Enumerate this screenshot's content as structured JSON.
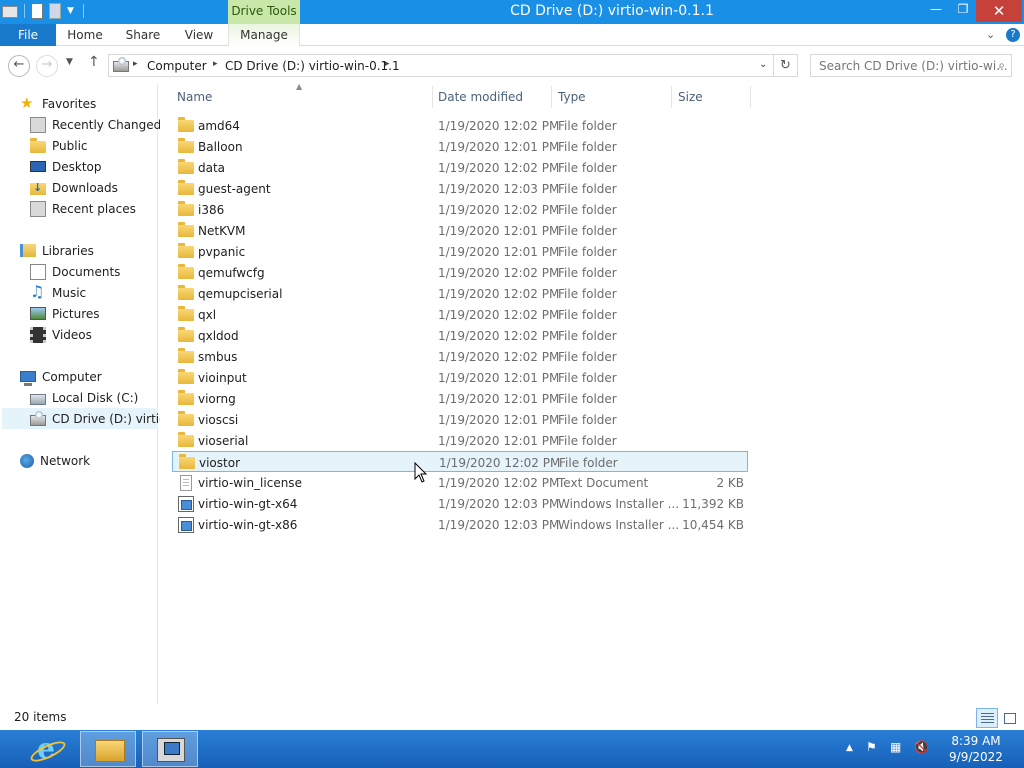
{
  "window": {
    "title": "CD Drive (D:) virtio-win-0.1.1",
    "context_tab": "Drive Tools"
  },
  "ribbon": {
    "tabs": [
      "File",
      "Home",
      "Share",
      "View",
      "Manage"
    ]
  },
  "address": {
    "crumbs": [
      "Computer",
      "CD Drive (D:) virtio-win-0.1.1"
    ],
    "search_placeholder": "Search CD Drive (D:) virtio-wi..."
  },
  "nav": {
    "favorites": "Favorites",
    "favorites_items": [
      "Recently Changed",
      "Public",
      "Desktop",
      "Downloads",
      "Recent places"
    ],
    "libraries": "Libraries",
    "libraries_items": [
      "Documents",
      "Music",
      "Pictures",
      "Videos"
    ],
    "computer": "Computer",
    "computer_items": [
      "Local Disk (C:)",
      "CD Drive (D:) virtio-w"
    ],
    "network": "Network"
  },
  "columns": {
    "name": "Name",
    "date": "Date modified",
    "type": "Type",
    "size": "Size"
  },
  "files": [
    {
      "name": "amd64",
      "date": "1/19/2020 12:02 PM",
      "type": "File folder",
      "size": "",
      "icon": "folder-icon"
    },
    {
      "name": "Balloon",
      "date": "1/19/2020 12:01 PM",
      "type": "File folder",
      "size": "",
      "icon": "folder-icon"
    },
    {
      "name": "data",
      "date": "1/19/2020 12:02 PM",
      "type": "File folder",
      "size": "",
      "icon": "folder-icon"
    },
    {
      "name": "guest-agent",
      "date": "1/19/2020 12:03 PM",
      "type": "File folder",
      "size": "",
      "icon": "folder-icon"
    },
    {
      "name": "i386",
      "date": "1/19/2020 12:02 PM",
      "type": "File folder",
      "size": "",
      "icon": "folder-icon"
    },
    {
      "name": "NetKVM",
      "date": "1/19/2020 12:01 PM",
      "type": "File folder",
      "size": "",
      "icon": "folder-icon"
    },
    {
      "name": "pvpanic",
      "date": "1/19/2020 12:01 PM",
      "type": "File folder",
      "size": "",
      "icon": "folder-icon"
    },
    {
      "name": "qemufwcfg",
      "date": "1/19/2020 12:02 PM",
      "type": "File folder",
      "size": "",
      "icon": "folder-icon"
    },
    {
      "name": "qemupciserial",
      "date": "1/19/2020 12:02 PM",
      "type": "File folder",
      "size": "",
      "icon": "folder-icon"
    },
    {
      "name": "qxl",
      "date": "1/19/2020 12:02 PM",
      "type": "File folder",
      "size": "",
      "icon": "folder-icon"
    },
    {
      "name": "qxldod",
      "date": "1/19/2020 12:02 PM",
      "type": "File folder",
      "size": "",
      "icon": "folder-icon"
    },
    {
      "name": "smbus",
      "date": "1/19/2020 12:02 PM",
      "type": "File folder",
      "size": "",
      "icon": "folder-icon"
    },
    {
      "name": "vioinput",
      "date": "1/19/2020 12:01 PM",
      "type": "File folder",
      "size": "",
      "icon": "folder-icon"
    },
    {
      "name": "viorng",
      "date": "1/19/2020 12:01 PM",
      "type": "File folder",
      "size": "",
      "icon": "folder-icon"
    },
    {
      "name": "vioscsi",
      "date": "1/19/2020 12:01 PM",
      "type": "File folder",
      "size": "",
      "icon": "folder-icon"
    },
    {
      "name": "vioserial",
      "date": "1/19/2020 12:01 PM",
      "type": "File folder",
      "size": "",
      "icon": "folder-icon"
    },
    {
      "name": "viostor",
      "date": "1/19/2020 12:02 PM",
      "type": "File folder",
      "size": "",
      "icon": "folder-icon",
      "hover": true
    },
    {
      "name": "virtio-win_license",
      "date": "1/19/2020 12:02 PM",
      "type": "Text Document",
      "size": "2 KB",
      "icon": "text-file-icon"
    },
    {
      "name": "virtio-win-gt-x64",
      "date": "1/19/2020 12:03 PM",
      "type": "Windows Installer ...",
      "size": "11,392 KB",
      "icon": "installer-icon"
    },
    {
      "name": "virtio-win-gt-x86",
      "date": "1/19/2020 12:03 PM",
      "type": "Windows Installer ...",
      "size": "10,454 KB",
      "icon": "installer-icon"
    }
  ],
  "status": {
    "item_count": "20 items"
  },
  "taskbar": {
    "time": "8:39 AM",
    "date": "9/9/2022"
  },
  "colors": {
    "titlebar": "#1a8fe6",
    "file_tab": "#1979ca",
    "drive_tools": "#c8e7a8",
    "hover_row": "#e5f3fb",
    "taskbar": "#1760b8"
  }
}
